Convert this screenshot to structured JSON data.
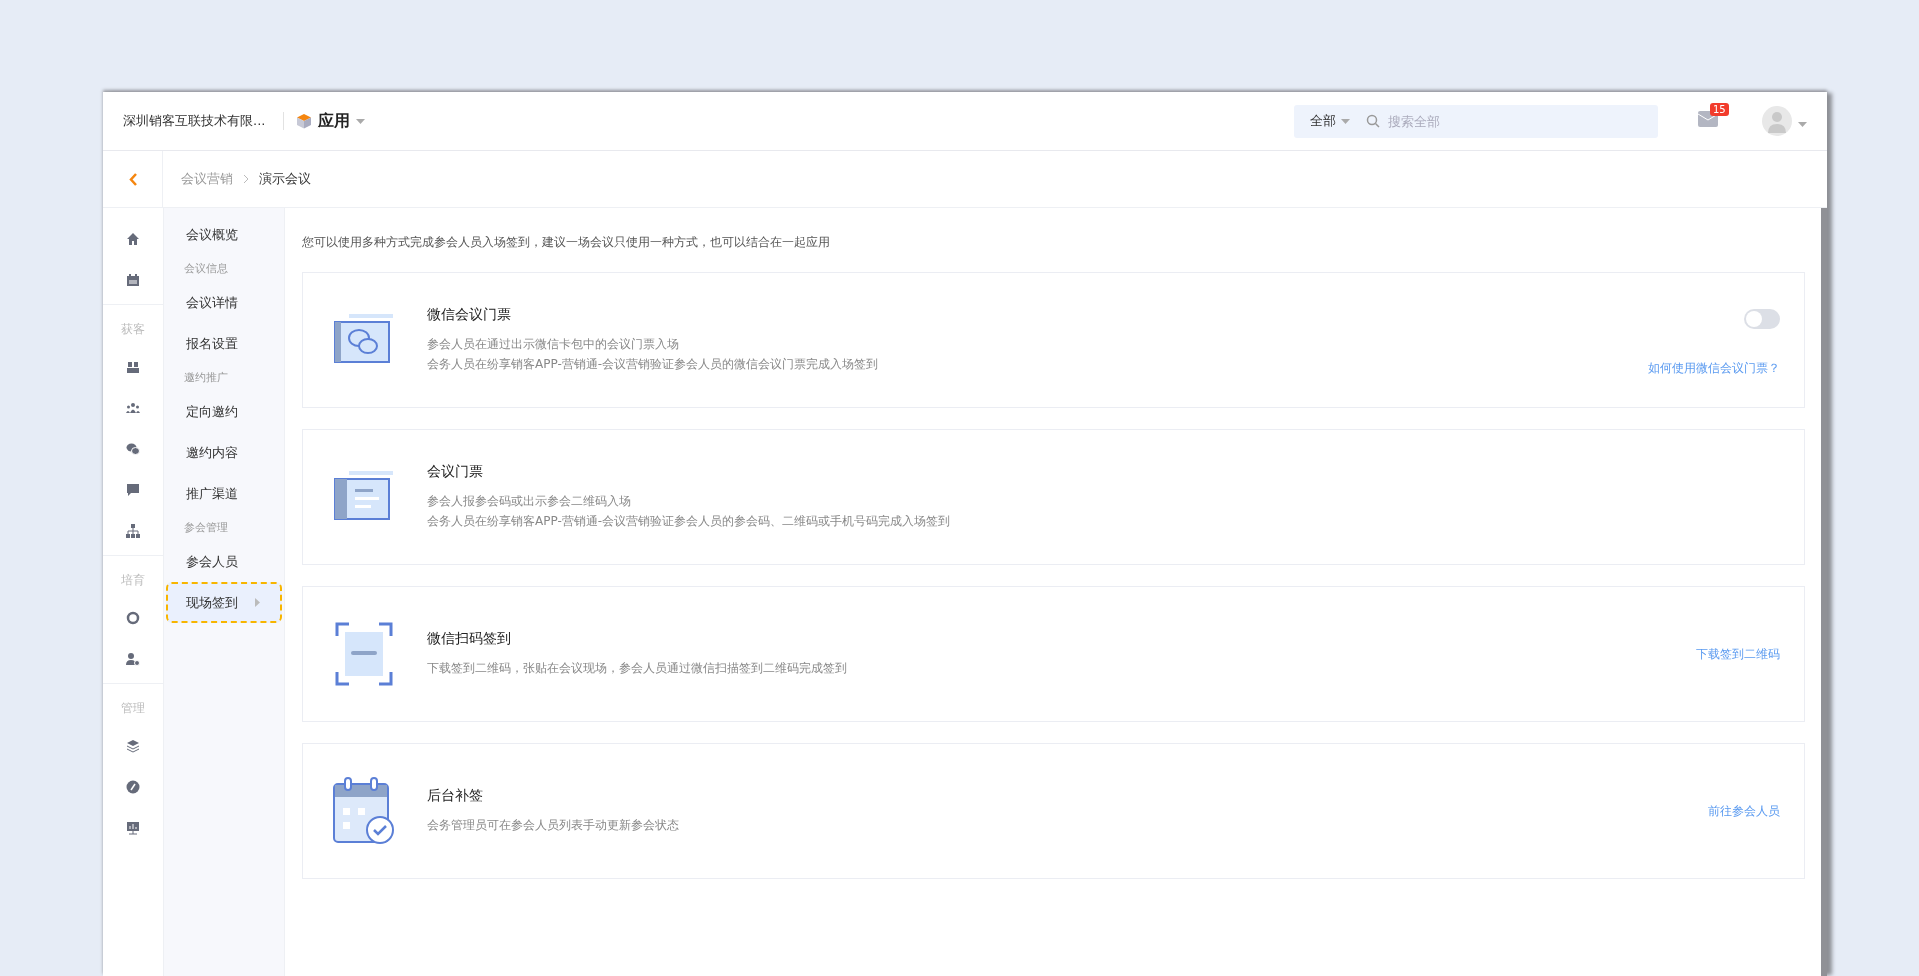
{
  "topbar": {
    "company": "深圳销客互联技术有限...",
    "app_menu": "应用",
    "search_scope": "全部",
    "search": {
      "placeholder": "搜索全部"
    },
    "mail_badge": "15"
  },
  "breadcrumb": [
    {
      "label": "会议营销"
    },
    {
      "label": "演示会议"
    }
  ],
  "rail": [
    {
      "kind": "icon"
    },
    {
      "kind": "icon"
    },
    {
      "kind": "label",
      "label": "获客"
    },
    {
      "kind": "icon"
    },
    {
      "kind": "icon"
    },
    {
      "kind": "icon"
    },
    {
      "kind": "icon"
    },
    {
      "kind": "icon"
    },
    {
      "kind": "label",
      "label": "培育"
    },
    {
      "kind": "icon"
    },
    {
      "kind": "icon"
    },
    {
      "kind": "label",
      "label": "管理"
    },
    {
      "kind": "icon"
    },
    {
      "kind": "icon"
    },
    {
      "kind": "icon"
    }
  ],
  "subnav": [
    {
      "kind": "item",
      "label": "会议概览",
      "selected": false
    },
    {
      "kind": "group",
      "label": "会议信息"
    },
    {
      "kind": "item",
      "label": "会议详情",
      "selected": false
    },
    {
      "kind": "item",
      "label": "报名设置",
      "selected": false
    },
    {
      "kind": "group",
      "label": "邀约推广"
    },
    {
      "kind": "item",
      "label": "定向邀约",
      "selected": false
    },
    {
      "kind": "item",
      "label": "邀约内容",
      "selected": false
    },
    {
      "kind": "item",
      "label": "推广渠道",
      "selected": false
    },
    {
      "kind": "group",
      "label": "参会管理"
    },
    {
      "kind": "item",
      "label": "参会人员",
      "selected": false
    },
    {
      "kind": "item",
      "label": "现场签到",
      "selected": true
    }
  ],
  "intro": "您可以使用多种方式完成参会人员入场签到，建议一场会议只使用一种方式，也可以结合在一起应用",
  "methods": [
    {
      "kind": "toggle",
      "title": "微信会议门票",
      "lines": [
        "参会人员在通过出示微信卡包中的会议门票入场",
        "会务人员在纷享销客APP-营销通-会议营销验证参会人员的微信会议门票完成入场签到"
      ],
      "on": false,
      "link": "如何使用微信会议门票？"
    },
    {
      "kind": "plain",
      "title": "会议门票",
      "lines": [
        "参会人报参会码或出示参会二维码入场",
        "会务人员在纷享销客APP-营销通-会议营销验证参会人员的参会码、二维码或手机号码完成入场签到"
      ]
    },
    {
      "kind": "link",
      "title": "微信扫码签到",
      "lines": [
        "下载签到二维码，张贴在会议现场，参会人员通过微信扫描签到二维码完成签到"
      ],
      "link": "下载签到二维码"
    },
    {
      "kind": "link",
      "title": "后台补签",
      "lines": [
        "会务管理员可在参会人员列表手动更新参会状态"
      ],
      "link": "前往参会人员"
    }
  ]
}
